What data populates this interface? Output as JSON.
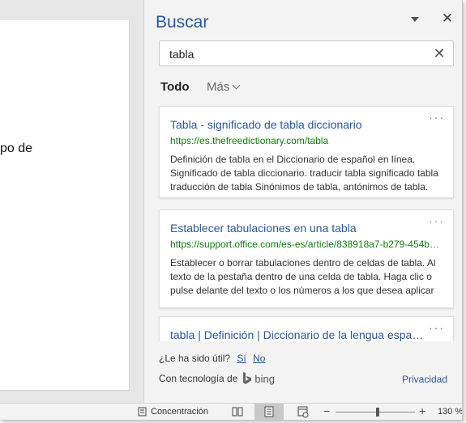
{
  "document": {
    "visible_text": "po de"
  },
  "search_pane": {
    "title": "Buscar",
    "search": {
      "value": "tabla",
      "clear_icon": "close-icon"
    },
    "tabs": {
      "all": "Todo",
      "more": "Más"
    },
    "results": [
      {
        "title": "Tabla - significado de tabla diccionario",
        "url": "https://es.thefreedictionary.com/tabla",
        "description": "Definición de tabla en el Diccionario de español en línea. Significado de tabla diccionario. traducir tabla significado tabla traducción de tabla Sinónimos de tabla, antónimos de tabla."
      },
      {
        "title": "Establecer tabulaciones en una tabla",
        "url": "https://support.office.com/es-es/article/838918a7-b279-454b…",
        "description": "Establecer o borrar tabulaciones dentro de celdas de tabla. Al texto de la pestaña dentro de una celda de tabla. Haga clic o pulse delante del texto o los números a los que desea aplicar"
      },
      {
        "title": "tabla | Definición | Diccionario de la lengua españ…",
        "url": "",
        "description": ""
      }
    ],
    "more_options": "···",
    "feedback": {
      "question": "¿Le ha sido útil?",
      "yes": "Sí",
      "no": "No"
    },
    "powered_by": "Con tecnología de",
    "bing": "bing",
    "privacy": "Privacidad"
  },
  "statusbar": {
    "focus": "Concentración",
    "zoom_minus": "−",
    "zoom_plus": "+",
    "zoom_level": "130 %"
  },
  "colors": {
    "accent": "#2b579a",
    "url_green": "#107c10"
  }
}
